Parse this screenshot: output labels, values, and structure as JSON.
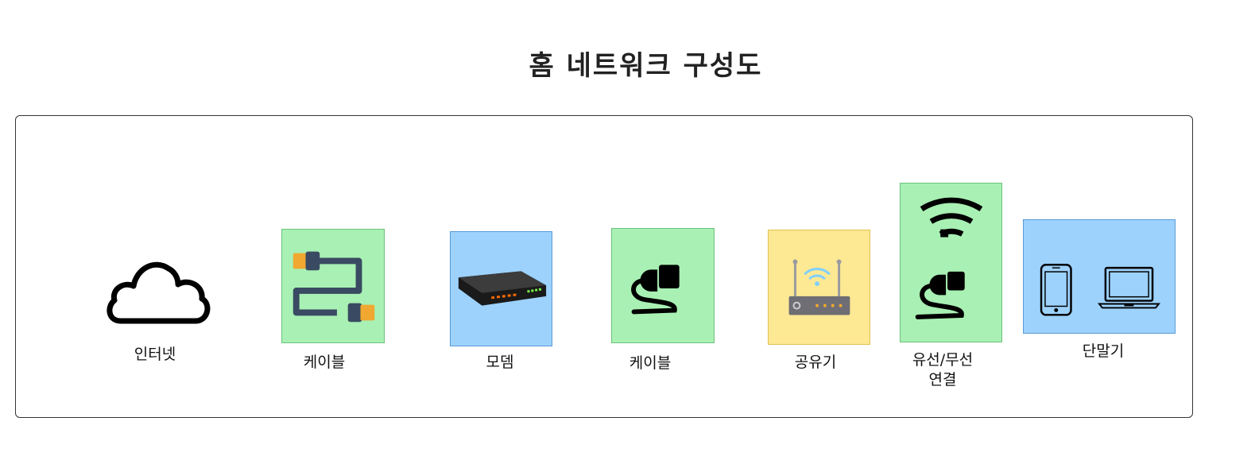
{
  "title": "홈 네트워크 구성도",
  "nodes": [
    {
      "label": "인터넷",
      "icon": "cloud-icon"
    },
    {
      "label": "케이블",
      "icon": "hdmi-cable-icon",
      "fill": "#a8f0b3"
    },
    {
      "label": "모뎀",
      "icon": "modem-icon",
      "fill": "#9dd2fd"
    },
    {
      "label": "케이블",
      "icon": "power-plug-icon",
      "fill": "#a8f0b3"
    },
    {
      "label": "공유기",
      "icon": "router-icon",
      "fill": "#fde893"
    },
    {
      "label_lines": [
        "유선/무선",
        "연결"
      ],
      "icons": [
        "wifi-icon",
        "power-plug-icon"
      ],
      "fill": "#a8f0b3"
    },
    {
      "label": "단말기",
      "icons": [
        "smartphone-icon",
        "laptop-icon"
      ],
      "fill": "#9dd2fd"
    }
  ]
}
